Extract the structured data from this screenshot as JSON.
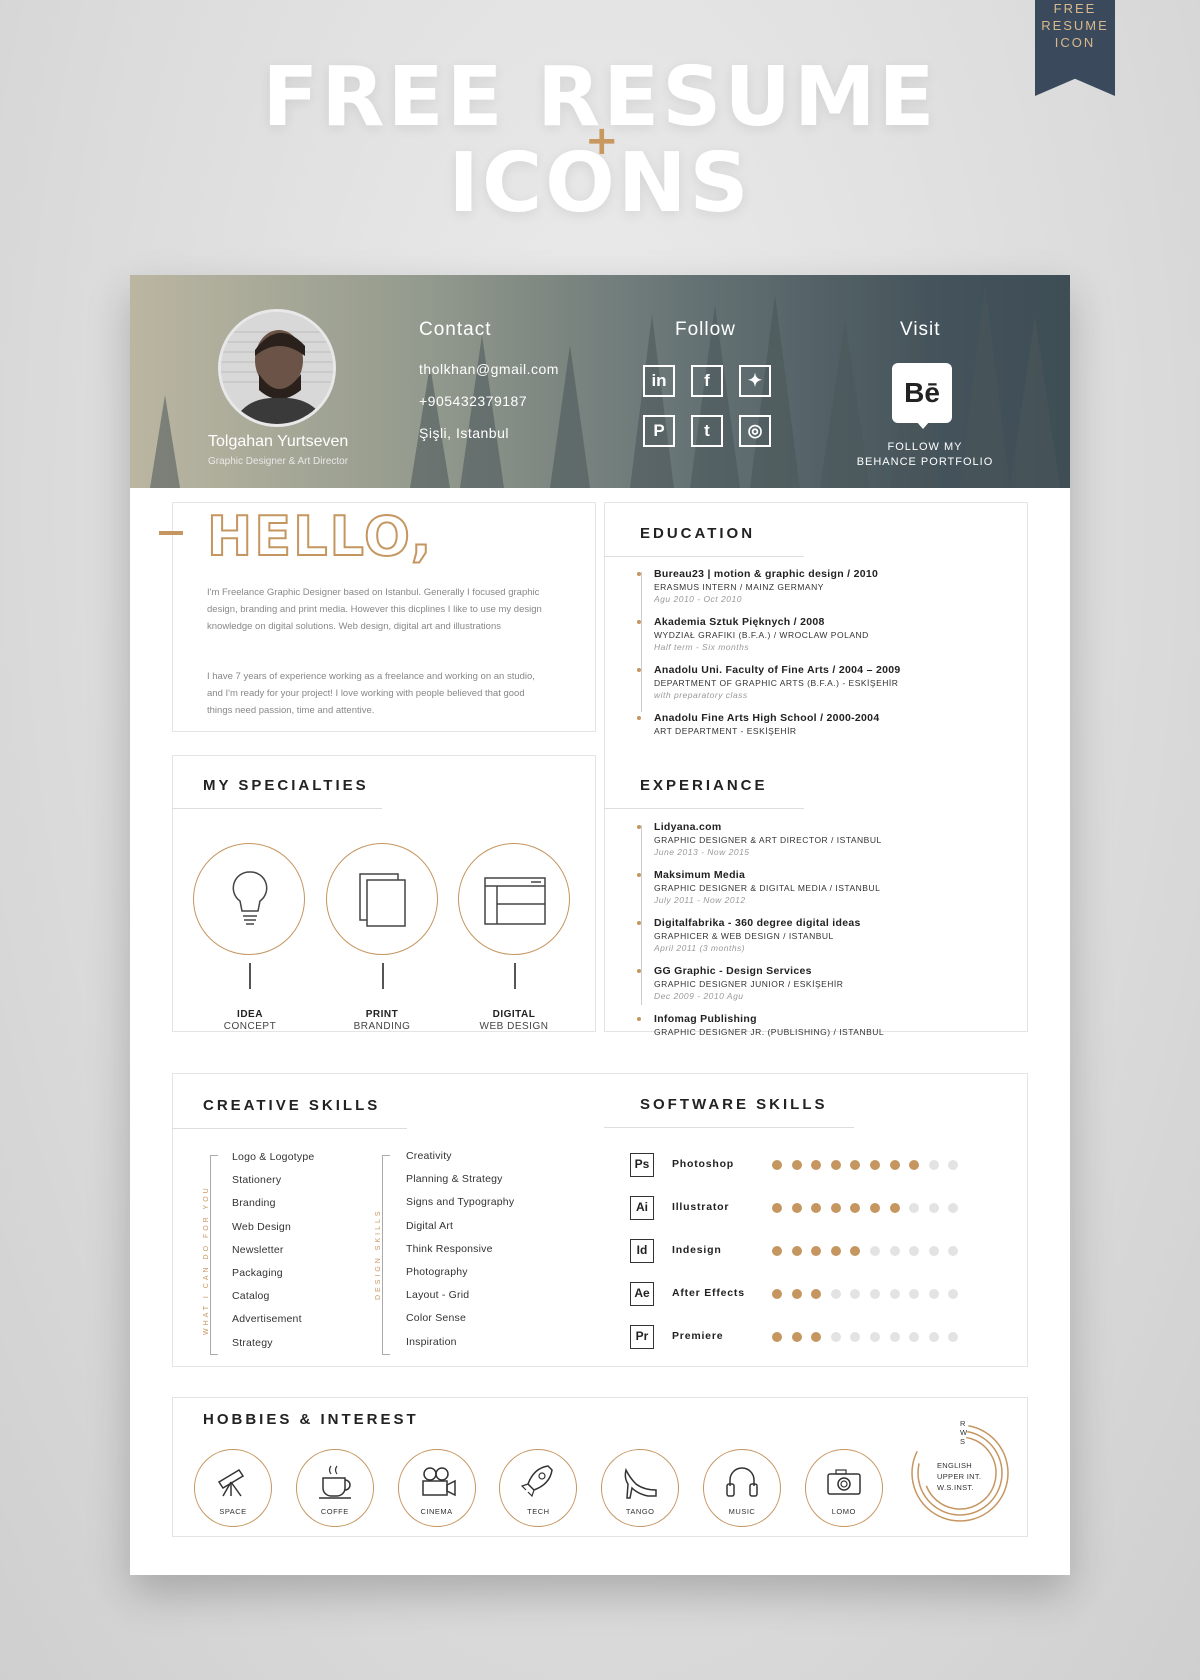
{
  "promo": {
    "title_line1": "FREE RESUME",
    "title_line2": "ICONS",
    "plus": "+",
    "ribbon": [
      "FREE",
      "RESUME",
      "ICON"
    ]
  },
  "profile": {
    "name": "Tolgahan Yurtseven",
    "role": "Graphic Designer & Art Director"
  },
  "contact": {
    "heading": "Contact",
    "email": "tholkhan@gmail.com",
    "phone": "+905432379187",
    "location": "Şişli, Istanbul"
  },
  "follow": {
    "heading": "Follow",
    "icons": [
      "linkedin-icon",
      "facebook-icon",
      "twitter-icon",
      "pinterest-icon",
      "tumblr-icon",
      "instagram-icon"
    ],
    "glyphs": [
      "in",
      "f",
      "✦",
      "P",
      "t",
      "◎"
    ]
  },
  "visit": {
    "heading": "Visit",
    "logo": "Bē",
    "note_line1": "FOLLOW MY",
    "note_line2": "BEHANCE PORTFOLIO"
  },
  "hello": {
    "title": "HELLO,",
    "p1": "I'm Freelance Graphic Designer based on Istanbul. Generally I focused graphic design, branding and print media. However this dicplines I like to use my design knowledge on digital solutions. Web design, digital art and illustrations",
    "p2": "I have 7 years of experience working as a freelance and working on an studio, and I'm ready for your project! I love working with people believed that good things need passion, time and attentive."
  },
  "education": {
    "heading": "EDUCATION",
    "items": [
      {
        "title": "Bureau23 | motion & graphic design / 2010",
        "sub": "ERASMUS INTERN / MAINZ GERMANY",
        "date": "Agu 2010 - Oct 2010"
      },
      {
        "title": "Akademia Sztuk Pięknych / 2008",
        "sub": "WYDZIAŁ GRAFIKI (B.F.A.) / WROCLAW POLAND",
        "date": "Half term - Six months"
      },
      {
        "title": "Anadolu Uni. Faculty of Fine Arts / 2004 – 2009",
        "sub": "DEPARTMENT OF GRAPHIC ARTS (B.F.A.) - ESKİŞEHİR",
        "date": "with preparatory class"
      },
      {
        "title": "Anadolu Fine Arts High School / 2000-2004",
        "sub": "ART DEPARTMENT - ESKİŞEHİR",
        "date": ""
      }
    ]
  },
  "specialties": {
    "heading": "MY SPECIALTIES",
    "items": [
      {
        "label": "IDEA",
        "sub": "CONCEPT"
      },
      {
        "label": "PRINT",
        "sub": "BRANDING"
      },
      {
        "label": "DIGITAL",
        "sub": "WEB DESIGN"
      }
    ]
  },
  "experience": {
    "heading": "EXPERIANCE",
    "items": [
      {
        "title": "Lidyana.com",
        "sub": "GRAPHIC DESIGNER & ART DIRECTOR / ISTANBUL",
        "date": "June 2013 - Now 2015"
      },
      {
        "title": "Maksimum Media",
        "sub": "GRAPHIC DESIGNER & DIGITAL MEDIA / ISTANBUL",
        "date": "July 2011 - Now 2012"
      },
      {
        "title": "Digitalfabrika - 360 degree digital ideas",
        "sub": "GRAPHICER & WEB DESIGN / ISTANBUL",
        "date": "April 2011 (3 months)"
      },
      {
        "title": "GG Graphic - Design Services",
        "sub": "GRAPHIC DESIGNER JUNIOR / ESKİŞEHİR",
        "date": "Dec 2009 - 2010 Agu"
      },
      {
        "title": "Infomag Publishing",
        "sub": "GRAPHIC DESIGNER JR. (PUBLISHING) / ISTANBUL",
        "date": ""
      }
    ]
  },
  "creative": {
    "heading": "CREATIVE SKILLS",
    "col1_caption": "WHAT I CAN DO FOR YOU",
    "col2_caption": "DESIGN SKILLS",
    "col1": [
      "Logo & Logotype",
      "Stationery",
      "Branding",
      "Web Design",
      "Newsletter",
      "Packaging",
      "Catalog",
      "Advertisement",
      "Strategy"
    ],
    "col2": [
      "Creativity",
      "Planning & Strategy",
      "Signs and Typography",
      "Digital Art",
      "Think Responsive",
      "Photography",
      "Layout - Grid",
      "Color Sense",
      "Inspiration"
    ]
  },
  "software": {
    "heading": "SOFTWARE SKILLS",
    "max": 10,
    "items": [
      {
        "abbr": "Ps",
        "name": "Photoshop",
        "level": 8
      },
      {
        "abbr": "Ai",
        "name": "Illustrator",
        "level": 7
      },
      {
        "abbr": "Id",
        "name": "Indesign",
        "level": 5
      },
      {
        "abbr": "Ae",
        "name": "After Effects",
        "level": 3
      },
      {
        "abbr": "Pr",
        "name": "Premiere",
        "level": 3
      }
    ]
  },
  "hobbies": {
    "heading": "HOBBIES & INTEREST",
    "items": [
      "SPACE",
      "COFFE",
      "CINEMA",
      "TECH",
      "TANGO",
      "MUSIC",
      "LOMO"
    ],
    "language": {
      "line1": "ENGLISH",
      "line2": "UPPER INT.",
      "line3": "W.S.INST.",
      "letters": [
        "R",
        "W",
        "S"
      ]
    }
  },
  "colors": {
    "accent": "#c59660",
    "dot_empty": "#e3e3e3",
    "text": "#222222"
  }
}
